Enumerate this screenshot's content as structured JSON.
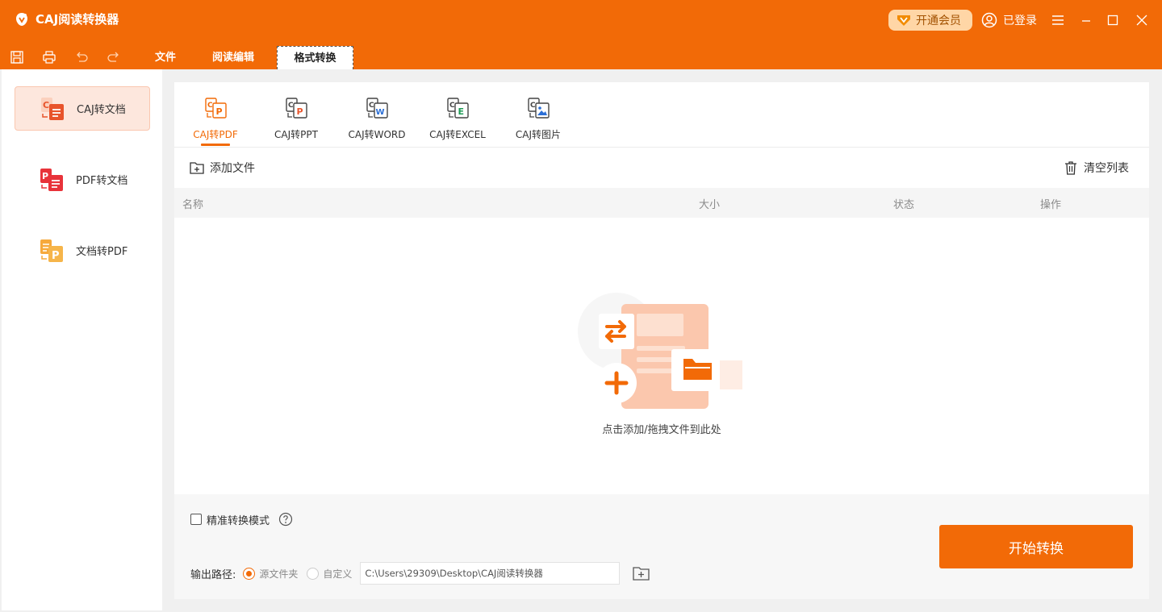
{
  "app": {
    "title": "CAJ阅读转换器"
  },
  "titlebar": {
    "vip_label": "开通会员",
    "user_label": "已登录"
  },
  "menu": {
    "tabs": [
      {
        "label": "文件"
      },
      {
        "label": "阅读编辑"
      },
      {
        "label": "格式转换",
        "active": true
      }
    ]
  },
  "sidebar": {
    "items": [
      {
        "label": "CAJ转文档",
        "active": true
      },
      {
        "label": "PDF转文档"
      },
      {
        "label": "文档转PDF"
      }
    ]
  },
  "convert_tabs": [
    {
      "label": "CAJ转PDF",
      "badge": "P",
      "active": true
    },
    {
      "label": "CAJ转PPT",
      "badge": "P"
    },
    {
      "label": "CAJ转WORD",
      "badge": "W"
    },
    {
      "label": "CAJ转EXCEL",
      "badge": "E"
    },
    {
      "label": "CAJ转图片",
      "badge": ""
    }
  ],
  "actions": {
    "add_file": "添加文件",
    "clear_list": "清空列表"
  },
  "table": {
    "headers": {
      "name": "名称",
      "size": "大小",
      "status": "状态",
      "ops": "操作"
    }
  },
  "empty": {
    "text": "点击添加/拖拽文件到此处"
  },
  "footer": {
    "precise_mode": "精准转换模式",
    "output_label": "输出路径:",
    "source_folder": "源文件夹",
    "custom": "自定义",
    "path_value": "C:\\Users\\29309\\Desktop\\CAJ阅读转换器",
    "start_button": "开始转换"
  },
  "colors": {
    "accent": "#f26a07",
    "vip_bg": "#ffd6a6",
    "active_side_bg": "#fde7dd"
  }
}
